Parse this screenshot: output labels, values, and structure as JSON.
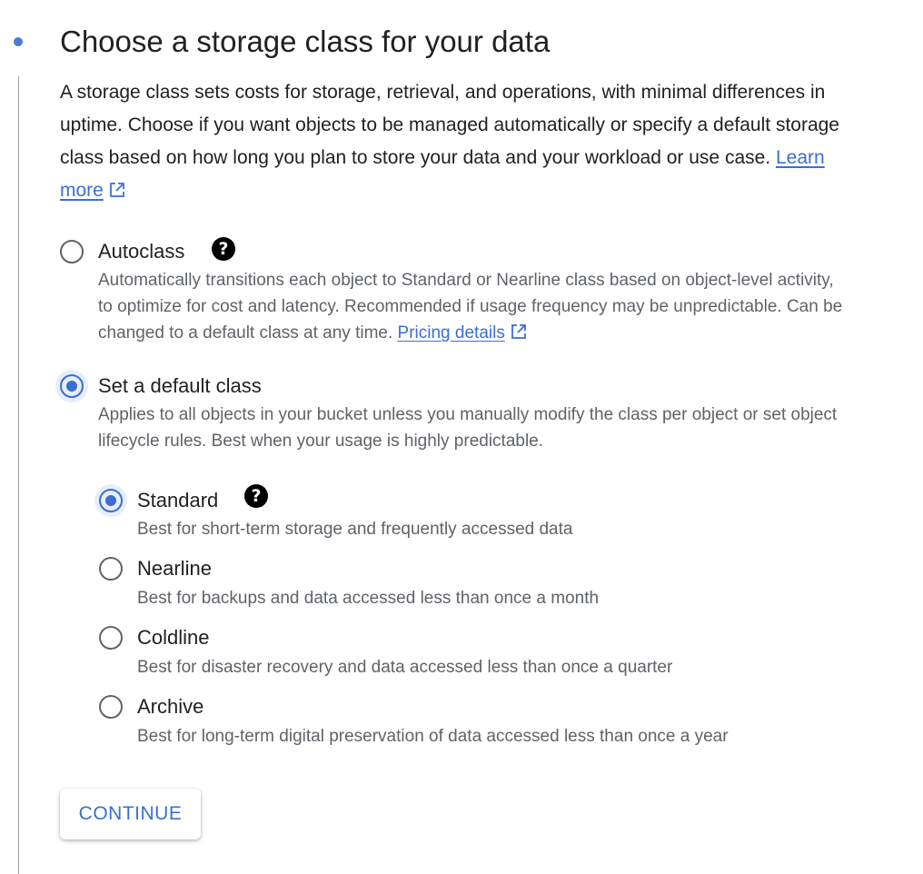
{
  "section": {
    "title": "Choose a storage class for your data",
    "intro_text": "A storage class sets costs for storage, retrieval, and operations, with minimal differences in uptime. Choose if you want objects to be managed automatically or specify a default storage class based on how long you plan to store your data and your workload or use case.",
    "learn_more_label": "Learn more"
  },
  "options": {
    "autoclass": {
      "label": "Autoclass",
      "description": "Automatically transitions each object to Standard or Nearline class based on object-level activity, to optimize for cost and latency. Recommended if usage frequency may be unpredictable. Can be changed to a default class at any time.",
      "pricing_link": "Pricing details",
      "selected": false
    },
    "default_class": {
      "label": "Set a default class",
      "description": "Applies to all objects in your bucket unless you manually modify the class per object or set object lifecycle rules. Best when your usage is highly predictable.",
      "selected": true
    }
  },
  "classes": [
    {
      "label": "Standard",
      "description": "Best for short-term storage and frequently accessed data",
      "selected": true
    },
    {
      "label": "Nearline",
      "description": "Best for backups and data accessed less than once a month",
      "selected": false
    },
    {
      "label": "Coldline",
      "description": "Best for disaster recovery and data accessed less than once a quarter",
      "selected": false
    },
    {
      "label": "Archive",
      "description": "Best for long-term digital preservation of data accessed less than once a year",
      "selected": false
    }
  ],
  "help_icon_glyph": "?",
  "continue_label": "CONTINUE",
  "colors": {
    "accent": "#3b6fd1",
    "text_primary": "#202124",
    "text_secondary": "#5f6368"
  }
}
